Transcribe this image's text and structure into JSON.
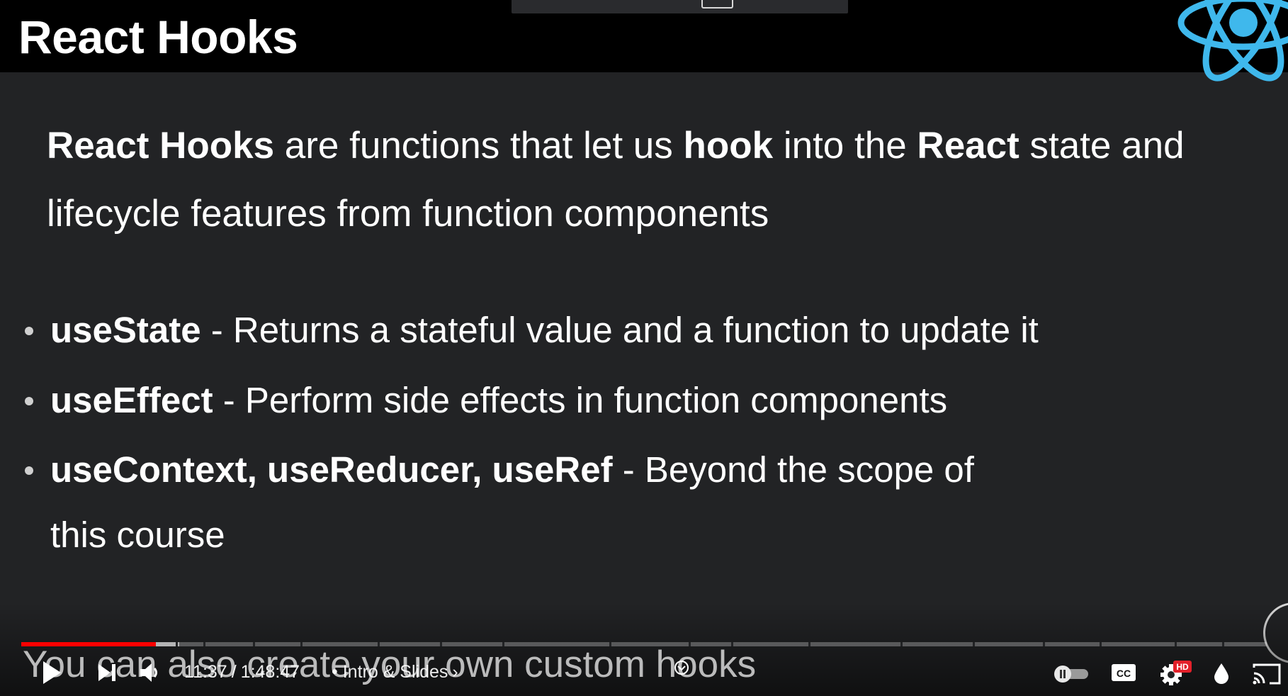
{
  "slide": {
    "title": "React Hooks",
    "intro": {
      "p1": "React Hooks",
      "p2": " are functions that let us ",
      "p3": "hook",
      "p4": " into the ",
      "p5": "React",
      "p6": " state and lifecycle features from function components"
    },
    "bullets": [
      {
        "term": "useState",
        "text": " - Returns a stateful value and a function to update it"
      },
      {
        "term": "useEffect",
        "text": " - Perform side effects in function components"
      },
      {
        "term": "useContext, useReducer, useRef",
        "text": " - Beyond the scope of this course"
      }
    ],
    "logo_icon": "react-atom-logo",
    "logo_color": "#3fb8ec"
  },
  "subtitle": "You can also create your own custom hooks",
  "player": {
    "current_time": "11:37",
    "time_separator": "/",
    "duration": "1:48:47",
    "chapter_prefix": "•",
    "chapter": "Intro & Slides",
    "chapter_chevron": "›",
    "progress_fraction": 0.108,
    "progress_color": "#ff0000",
    "hd_badge": "HD",
    "cc_label": "CC",
    "icons": [
      "play-icon",
      "next-icon",
      "volume-icon",
      "chevron-icon",
      "autoplay-toggle-icon",
      "cc-icon",
      "settings-icon",
      "ambient-icon",
      "cast-icon"
    ]
  }
}
